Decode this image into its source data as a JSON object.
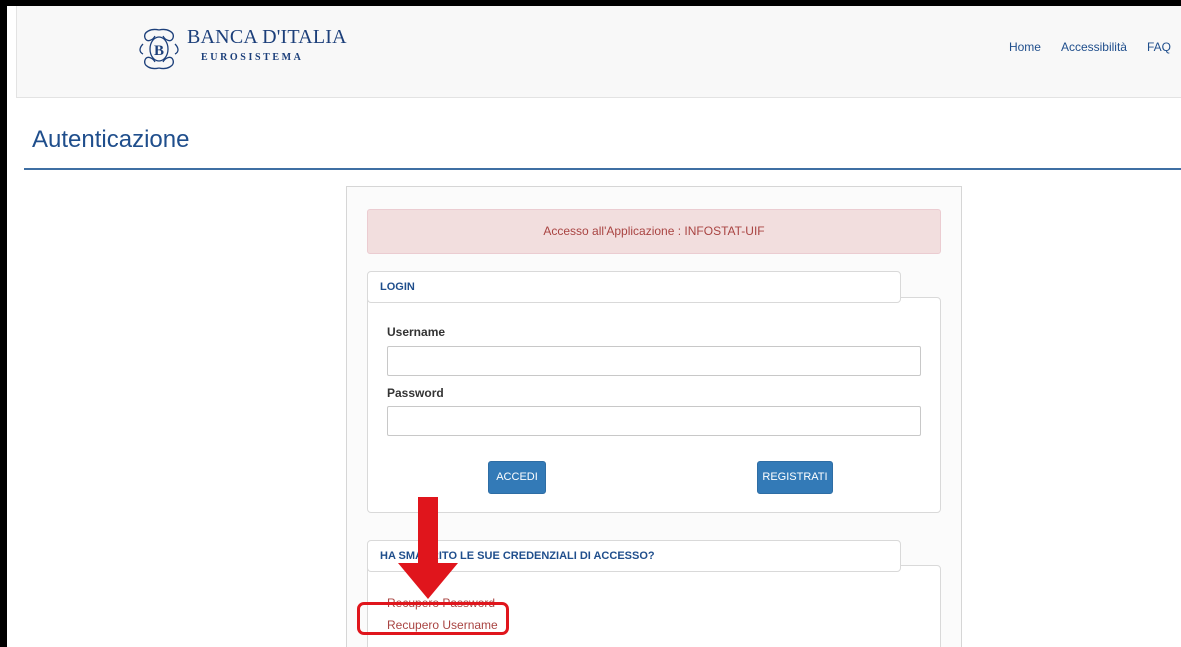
{
  "header": {
    "brand_title": "BANCA D'ITALIA",
    "brand_subtitle": "EUROSISTEMA",
    "nav": [
      {
        "label": "Home"
      },
      {
        "label": "Accessibilità"
      },
      {
        "label": "FAQ"
      }
    ]
  },
  "page": {
    "title": "Autenticazione"
  },
  "alert": {
    "text": "Accesso all'Applicazione : INFOSTAT-UIF"
  },
  "login": {
    "legend": "LOGIN",
    "username_label": "Username",
    "username_value": "",
    "password_label": "Password",
    "password_value": "",
    "accedi_label": "ACCEDI",
    "registrati_label": "REGISTRATI"
  },
  "recover": {
    "legend": "HA SMARRITO LE SUE CREDENZIALI DI ACCESSO?",
    "password_link": "Recupero Password",
    "username_link": "Recupero Username"
  },
  "colors": {
    "brand": "#1c3f7a",
    "link_blue": "#1f4e8c",
    "button": "#337ab7",
    "alert_bg": "#f2dede",
    "alert_text": "#a94442",
    "annotation_red": "#e0151c"
  }
}
